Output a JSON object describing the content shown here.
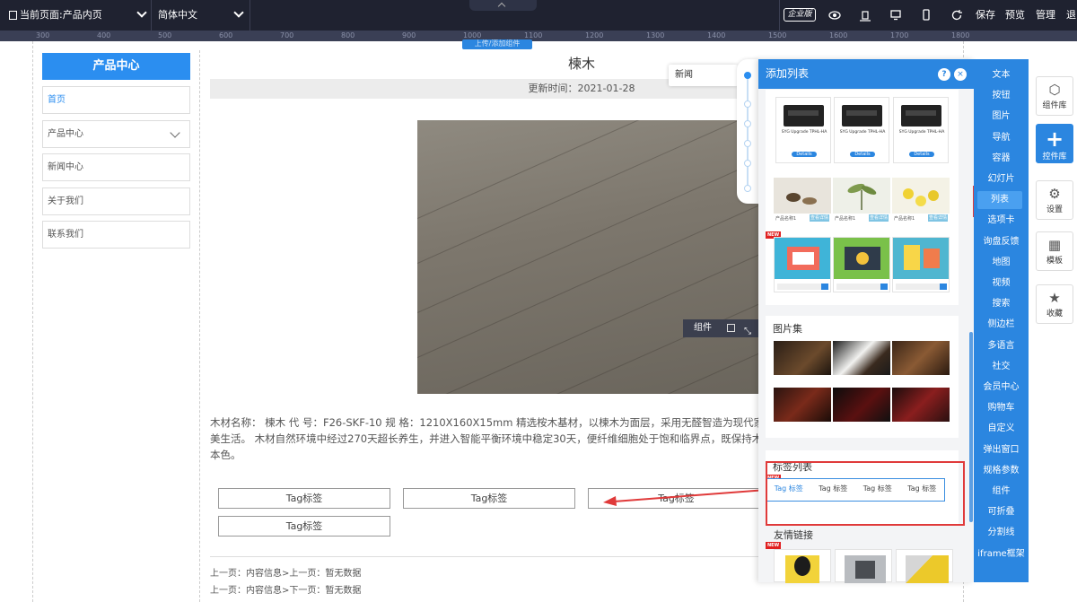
{
  "topbar": {
    "current_page": "当前页面:产品内页",
    "language": "简体中文",
    "edition_badge": "企业版",
    "save": "保存",
    "preview": "预览",
    "manage": "管理",
    "exit": "退"
  },
  "ruler": [
    "300",
    "400",
    "500",
    "600",
    "700",
    "800",
    "900",
    "1000",
    "1100",
    "1200",
    "1300",
    "1400",
    "1500",
    "1600",
    "1700",
    "1800"
  ],
  "canvas_button": "上传/添加组件",
  "sidebar": {
    "header": "产品中心",
    "items": [
      {
        "label": "首页"
      },
      {
        "label": "产品中心"
      },
      {
        "label": "新闻中心"
      },
      {
        "label": "关于我们"
      },
      {
        "label": "联系我们"
      }
    ]
  },
  "article": {
    "title": "楝木",
    "updated": "更新时间：2021-01-28",
    "widget_toolbar_label": "组件",
    "description_lines": [
      "木材名称：  楝木 代 号：F26-SKF-10 规 格：1210X160X15mm 精选桉木基材，以楝木为面层，采用无醛智造为现代家居生活带",
      "美生活。 木材自然环境中经过270天超长养生，并进入智能平衡环境中稳定30天，便纤维细胞处于饱和临界点，既保持木材活性",
      "本色。"
    ],
    "tags": [
      "Tag标签",
      "Tag标签",
      "Tag标签",
      "Tag标签"
    ],
    "prev": "上一页：内容信息>上一页：暂无数据",
    "next": "上一页：内容信息>下一页：暂无数据"
  },
  "news_tab": "新闻",
  "panel": {
    "title": "添加列表",
    "help": "?",
    "close": "×",
    "product_title": "SYG Upgrade TPHL-HA",
    "product_btn": "Details",
    "shop_text": "产品名称1",
    "shop_btn": "查看详情",
    "new_badge": "NEW",
    "gallery_label": "图片集",
    "tag_list_label": "标签列表",
    "tag_items": [
      "Tag 标签",
      "Tag 标签",
      "Tag 标签",
      "Tag 标签"
    ],
    "links_label": "友情链接"
  },
  "categories": [
    "文本",
    "按钮",
    "图片",
    "导航",
    "容器",
    "幻灯片",
    "列表",
    "选项卡",
    "询盘反馈",
    "地图",
    "视频",
    "搜索",
    "侧边栏",
    "多语言",
    "社交",
    "会员中心",
    "购物车",
    "自定义",
    "弹出窗口",
    "规格参数",
    "组件",
    "可折叠",
    "分割线",
    "iframe框架"
  ],
  "selected_category": "列表",
  "right_tools": [
    {
      "label": "组件库",
      "icon": "cube-icon"
    },
    {
      "label": "控件库",
      "icon": "plus-icon"
    },
    {
      "label": "设置",
      "icon": "gear-icon"
    },
    {
      "label": "模板",
      "icon": "grid-icon"
    },
    {
      "label": "收藏",
      "icon": "star-icon"
    }
  ],
  "colors": {
    "accent": "#2b86e0",
    "topbar": "#1f2230",
    "highlight": "#e03a3a"
  }
}
